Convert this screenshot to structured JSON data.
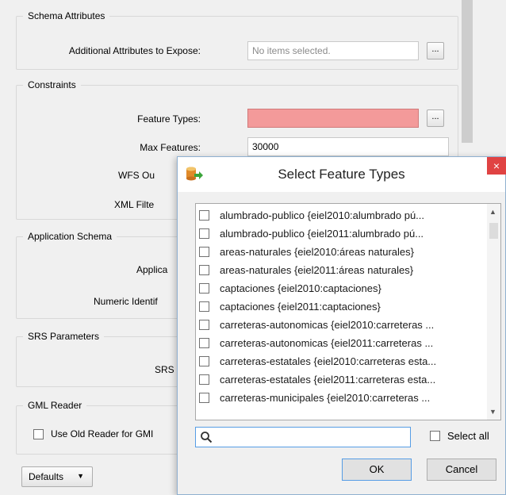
{
  "params": {
    "schema_attributes": {
      "title": "Schema Attributes",
      "additional_label": "Additional Attributes to Expose:",
      "additional_placeholder": "No items selected.",
      "browse": "..."
    },
    "constraints": {
      "title": "Constraints",
      "feature_types_label": "Feature Types:",
      "feature_types_browse": "...",
      "max_features_label": "Max Features:",
      "max_features_value": "30000",
      "wfs_label_partial": "WFS Ou",
      "xml_filter_label_partial": "XML Filte"
    },
    "application_schema": {
      "title": "Application Schema",
      "applica_partial": "Applica",
      "numeric_partial": "Numeric Identif"
    },
    "srs_parameters": {
      "title": "SRS Parameters",
      "srs_partial": "SRS"
    },
    "gml_reader": {
      "title": "GML Reader",
      "old_reader_partial": "Use Old Reader for GMI"
    },
    "defaults_button": "Defaults"
  },
  "dialog": {
    "title": "Select Feature Types",
    "close": "×",
    "items": [
      "alumbrado-publico {eiel2010:alumbrado pú...",
      "alumbrado-publico {eiel2011:alumbrado pú...",
      "areas-naturales {eiel2010:áreas naturales}",
      "areas-naturales {eiel2011:áreas naturales}",
      "captaciones {eiel2010:captaciones}",
      "captaciones {eiel2011:captaciones}",
      "carreteras-autonomicas {eiel2010:carreteras ...",
      "carreteras-autonomicas {eiel2011:carreteras ...",
      "carreteras-estatales {eiel2010:carreteras esta...",
      "carreteras-estatales {eiel2011:carreteras esta...",
      "carreteras-municipales {eiel2010:carreteras ..."
    ],
    "search_value": "",
    "select_all_label": "Select all",
    "ok": "OK",
    "cancel": "Cancel"
  },
  "colors": {
    "invalid_field": "#f39a9a",
    "close_button": "#e04343",
    "focus_border": "#569de5"
  }
}
